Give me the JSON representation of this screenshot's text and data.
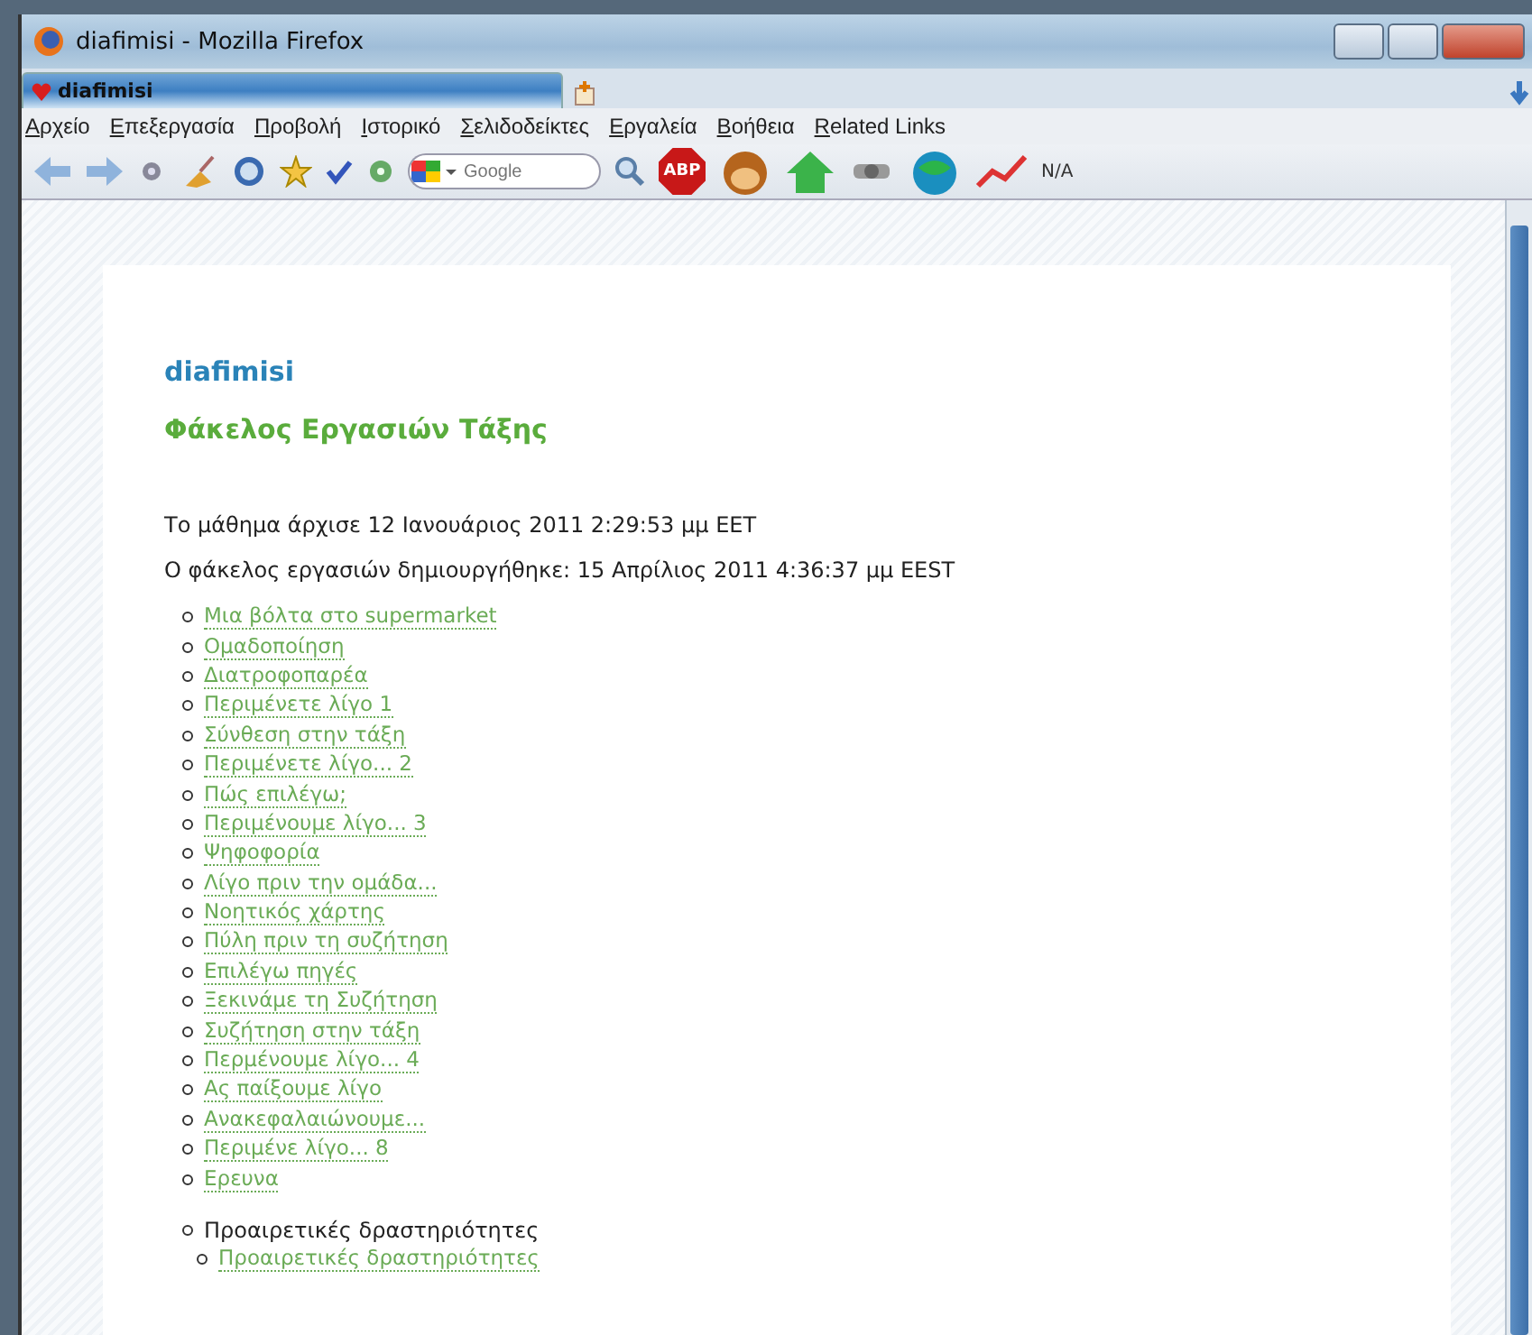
{
  "window": {
    "title": "diafimisi - Mozilla Firefox"
  },
  "tabs": [
    {
      "label": "diafimisi",
      "selected": true
    }
  ],
  "menu": [
    "Αρχείο",
    "Επεξεργασία",
    "Προβολή",
    "Ιστορικό",
    "Σελιδοδείκτες",
    "Εργαλεία",
    "Βοήθεια",
    "Related Links"
  ],
  "toolbar": {
    "search": {
      "placeholder": "Google"
    },
    "adblock_label": "ABP",
    "status_text": "N/A"
  },
  "page": {
    "site_title": "diafimisi",
    "heading": "Φάκελος Εργασιών Τάξης",
    "info": [
      "Το μάθημα άρχισε 12 Ιανουάριος 2011 2:29:53 μμ EET",
      "Ο φάκελος εργασιών δημιουργήθηκε: 15 Απρίλιος 2011 4:36:37 μμ EEST"
    ],
    "activities": [
      {
        "label": "Μια βόλτα στο supermarket"
      },
      {
        "label": "Ομαδοποίηση"
      },
      {
        "label": "Διατροφοπαρέα"
      },
      {
        "label": "Περιμένετε λίγο 1"
      },
      {
        "label": "Σύνθεση στην τάξη"
      },
      {
        "label": "Περιμένετε λίγο... 2"
      },
      {
        "label": "Πώς επιλέγω;"
      },
      {
        "label": "Περιμένουμε λίγο... 3"
      },
      {
        "label": "Ψηφοφορία"
      },
      {
        "label": "Λίγο πριν την ομάδα..."
      },
      {
        "label": "Νοητικός χάρτης"
      },
      {
        "label": "Πύλη πριν τη συζήτηση"
      },
      {
        "label": "Επιλέγω πηγές"
      },
      {
        "label": "Ξεκινάμε τη Συζήτηση"
      },
      {
        "label": "Συζήτηση στην τάξη"
      },
      {
        "label": "Περμένουμε λίγο... 4"
      },
      {
        "label": "Ας παίξουμε λίγο"
      },
      {
        "label": "Ανακεφαλαιώνουμε..."
      },
      {
        "label": "Περιμένε λίγο... 8"
      },
      {
        "label": "Ερευνα"
      }
    ],
    "sections": [
      {
        "label": "Προαιρετικές δραστηριότητες",
        "children": [
          {
            "label": "Προαιρετικές δραστηριότητες"
          }
        ]
      }
    ]
  }
}
